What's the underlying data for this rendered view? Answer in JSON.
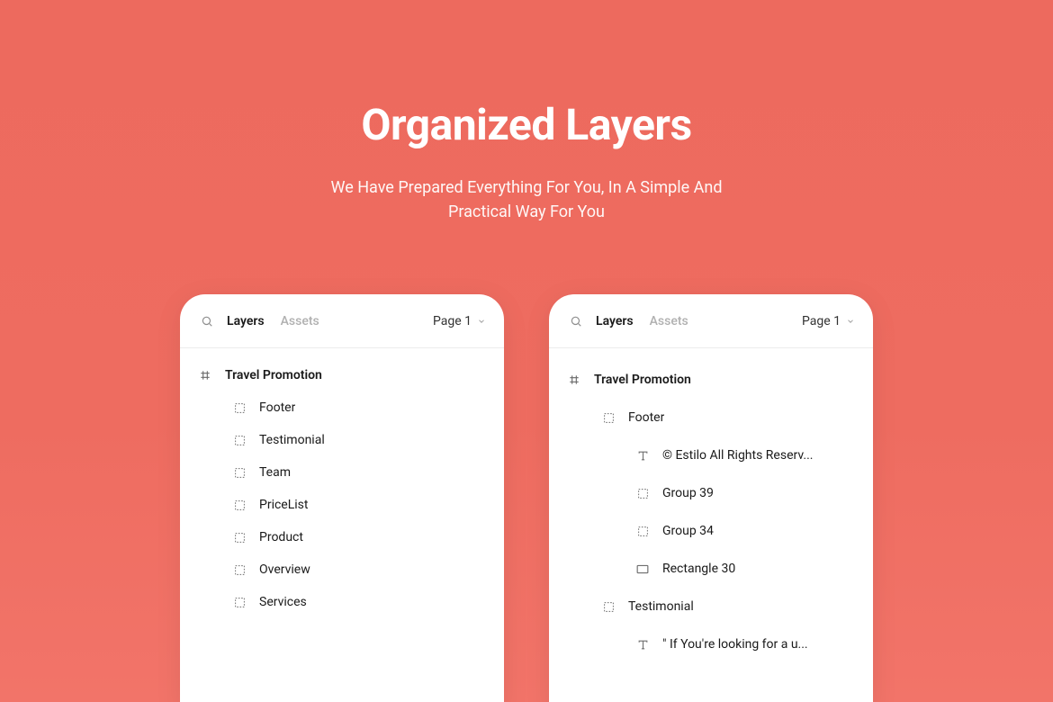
{
  "hero": {
    "title": "Organized Layers",
    "subtitle_line1": "We Have Prepared Everything For You, In A Simple And",
    "subtitle_line2": "Practical Way For You"
  },
  "panels": {
    "left": {
      "tabs": {
        "layers": "Layers",
        "assets": "Assets"
      },
      "page_label": "Page 1",
      "root": "Travel Promotion",
      "items": [
        {
          "label": "Footer",
          "icon": "group"
        },
        {
          "label": "Testimonial",
          "icon": "group"
        },
        {
          "label": "Team",
          "icon": "group"
        },
        {
          "label": "PriceList",
          "icon": "group"
        },
        {
          "label": "Product",
          "icon": "group"
        },
        {
          "label": "Overview",
          "icon": "group"
        },
        {
          "label": "Services",
          "icon": "group"
        }
      ]
    },
    "right": {
      "tabs": {
        "layers": "Layers",
        "assets": "Assets"
      },
      "page_label": "Page 1",
      "root": "Travel Promotion",
      "tree": [
        {
          "depth": 1,
          "icon": "group",
          "label": "Footer"
        },
        {
          "depth": 2,
          "icon": "text",
          "label": "© Estilo All Rights Reserv..."
        },
        {
          "depth": 2,
          "icon": "group",
          "label": "Group 39"
        },
        {
          "depth": 2,
          "icon": "group",
          "label": "Group 34"
        },
        {
          "depth": 2,
          "icon": "rect",
          "label": "Rectangle 30"
        },
        {
          "depth": 1,
          "icon": "group",
          "label": "Testimonial"
        },
        {
          "depth": 2,
          "icon": "text",
          "label": "\" If You're looking for a u..."
        }
      ]
    }
  }
}
